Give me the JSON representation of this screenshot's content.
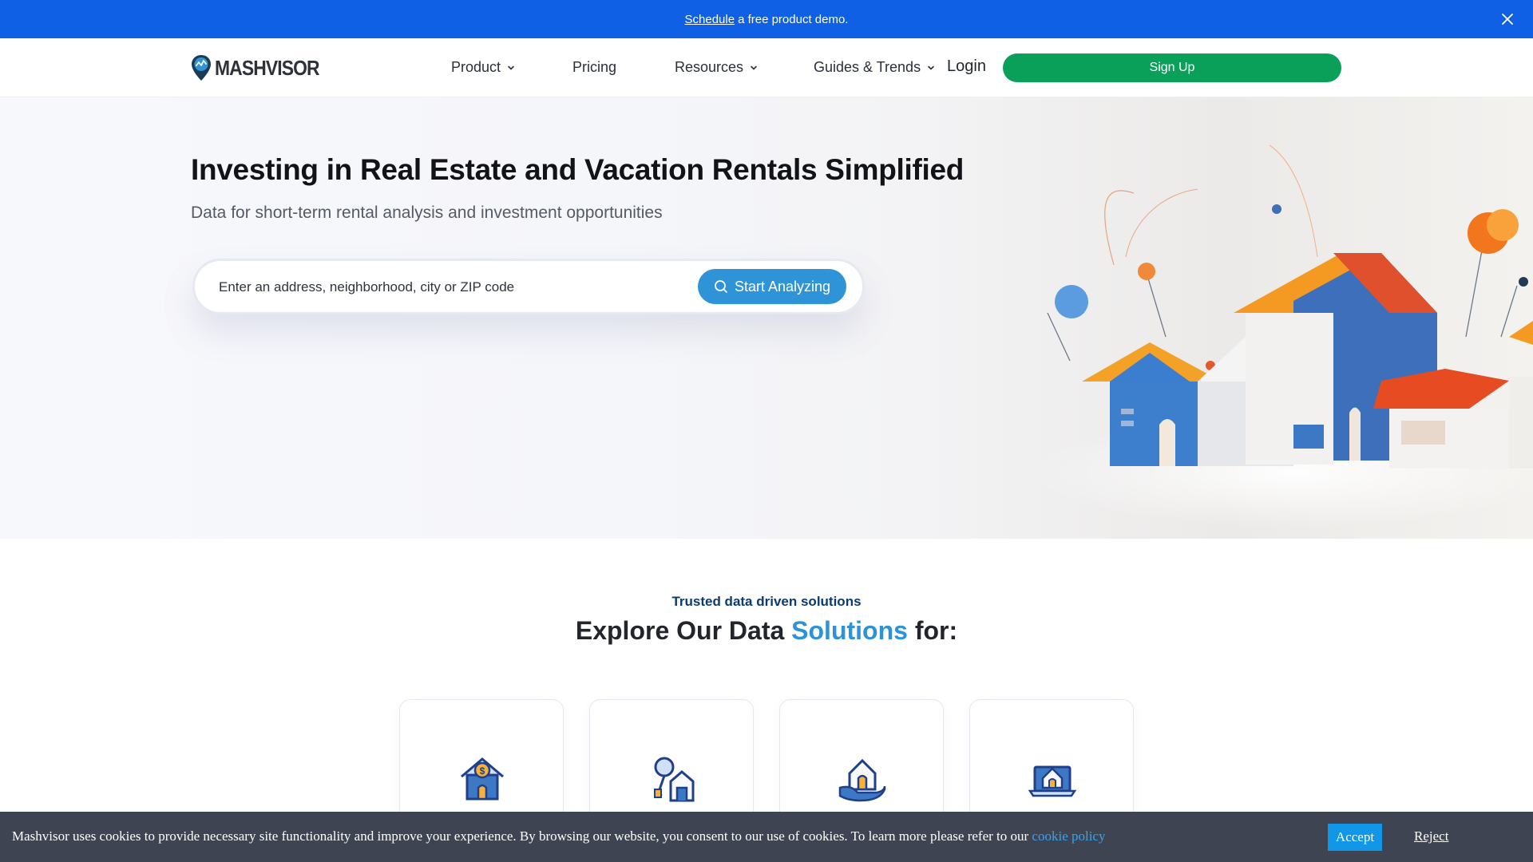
{
  "banner": {
    "link_label": "Schedule",
    "text": "a free product demo.",
    "close_icon": "close-icon"
  },
  "nav": {
    "logo_text": "MASHVISOR",
    "items": [
      {
        "label": "Product",
        "has_dropdown": true
      },
      {
        "label": "Pricing",
        "has_dropdown": false
      },
      {
        "label": "Resources",
        "has_dropdown": true
      },
      {
        "label": "Guides & Trends",
        "has_dropdown": true
      }
    ],
    "login_label": "Login",
    "signup_label": "Sign Up"
  },
  "hero": {
    "title": "Investing in Real Estate and Vacation Rentals Simplified",
    "subtitle": "Data for short-term rental analysis and investment opportunities",
    "search_placeholder": "Enter an address, neighborhood, city or ZIP code",
    "search_button_label": "Start Analyzing"
  },
  "solutions": {
    "kicker": "Trusted data driven solutions",
    "title_prefix": "Explore Our Data ",
    "title_accent": "Solutions",
    "title_suffix": " for:",
    "cards": [
      {
        "icon": "house-dollar-icon"
      },
      {
        "icon": "house-key-icon"
      },
      {
        "icon": "hand-house-icon"
      },
      {
        "icon": "laptop-house-icon"
      }
    ]
  },
  "cookie": {
    "text": "Mashvisor uses cookies to provide necessary site functionality and improve your experience. By browsing our website, you consent to our use of cookies. To learn more please refer to our ",
    "link_label": "cookie policy",
    "accept_label": "Accept",
    "reject_label": "Reject"
  },
  "colors": {
    "banner": "#1060e6",
    "signup": "#0aa05a",
    "search_button": "#2f93d8",
    "accent": "#2d92d8",
    "cookie_bar": "#3e4451"
  }
}
